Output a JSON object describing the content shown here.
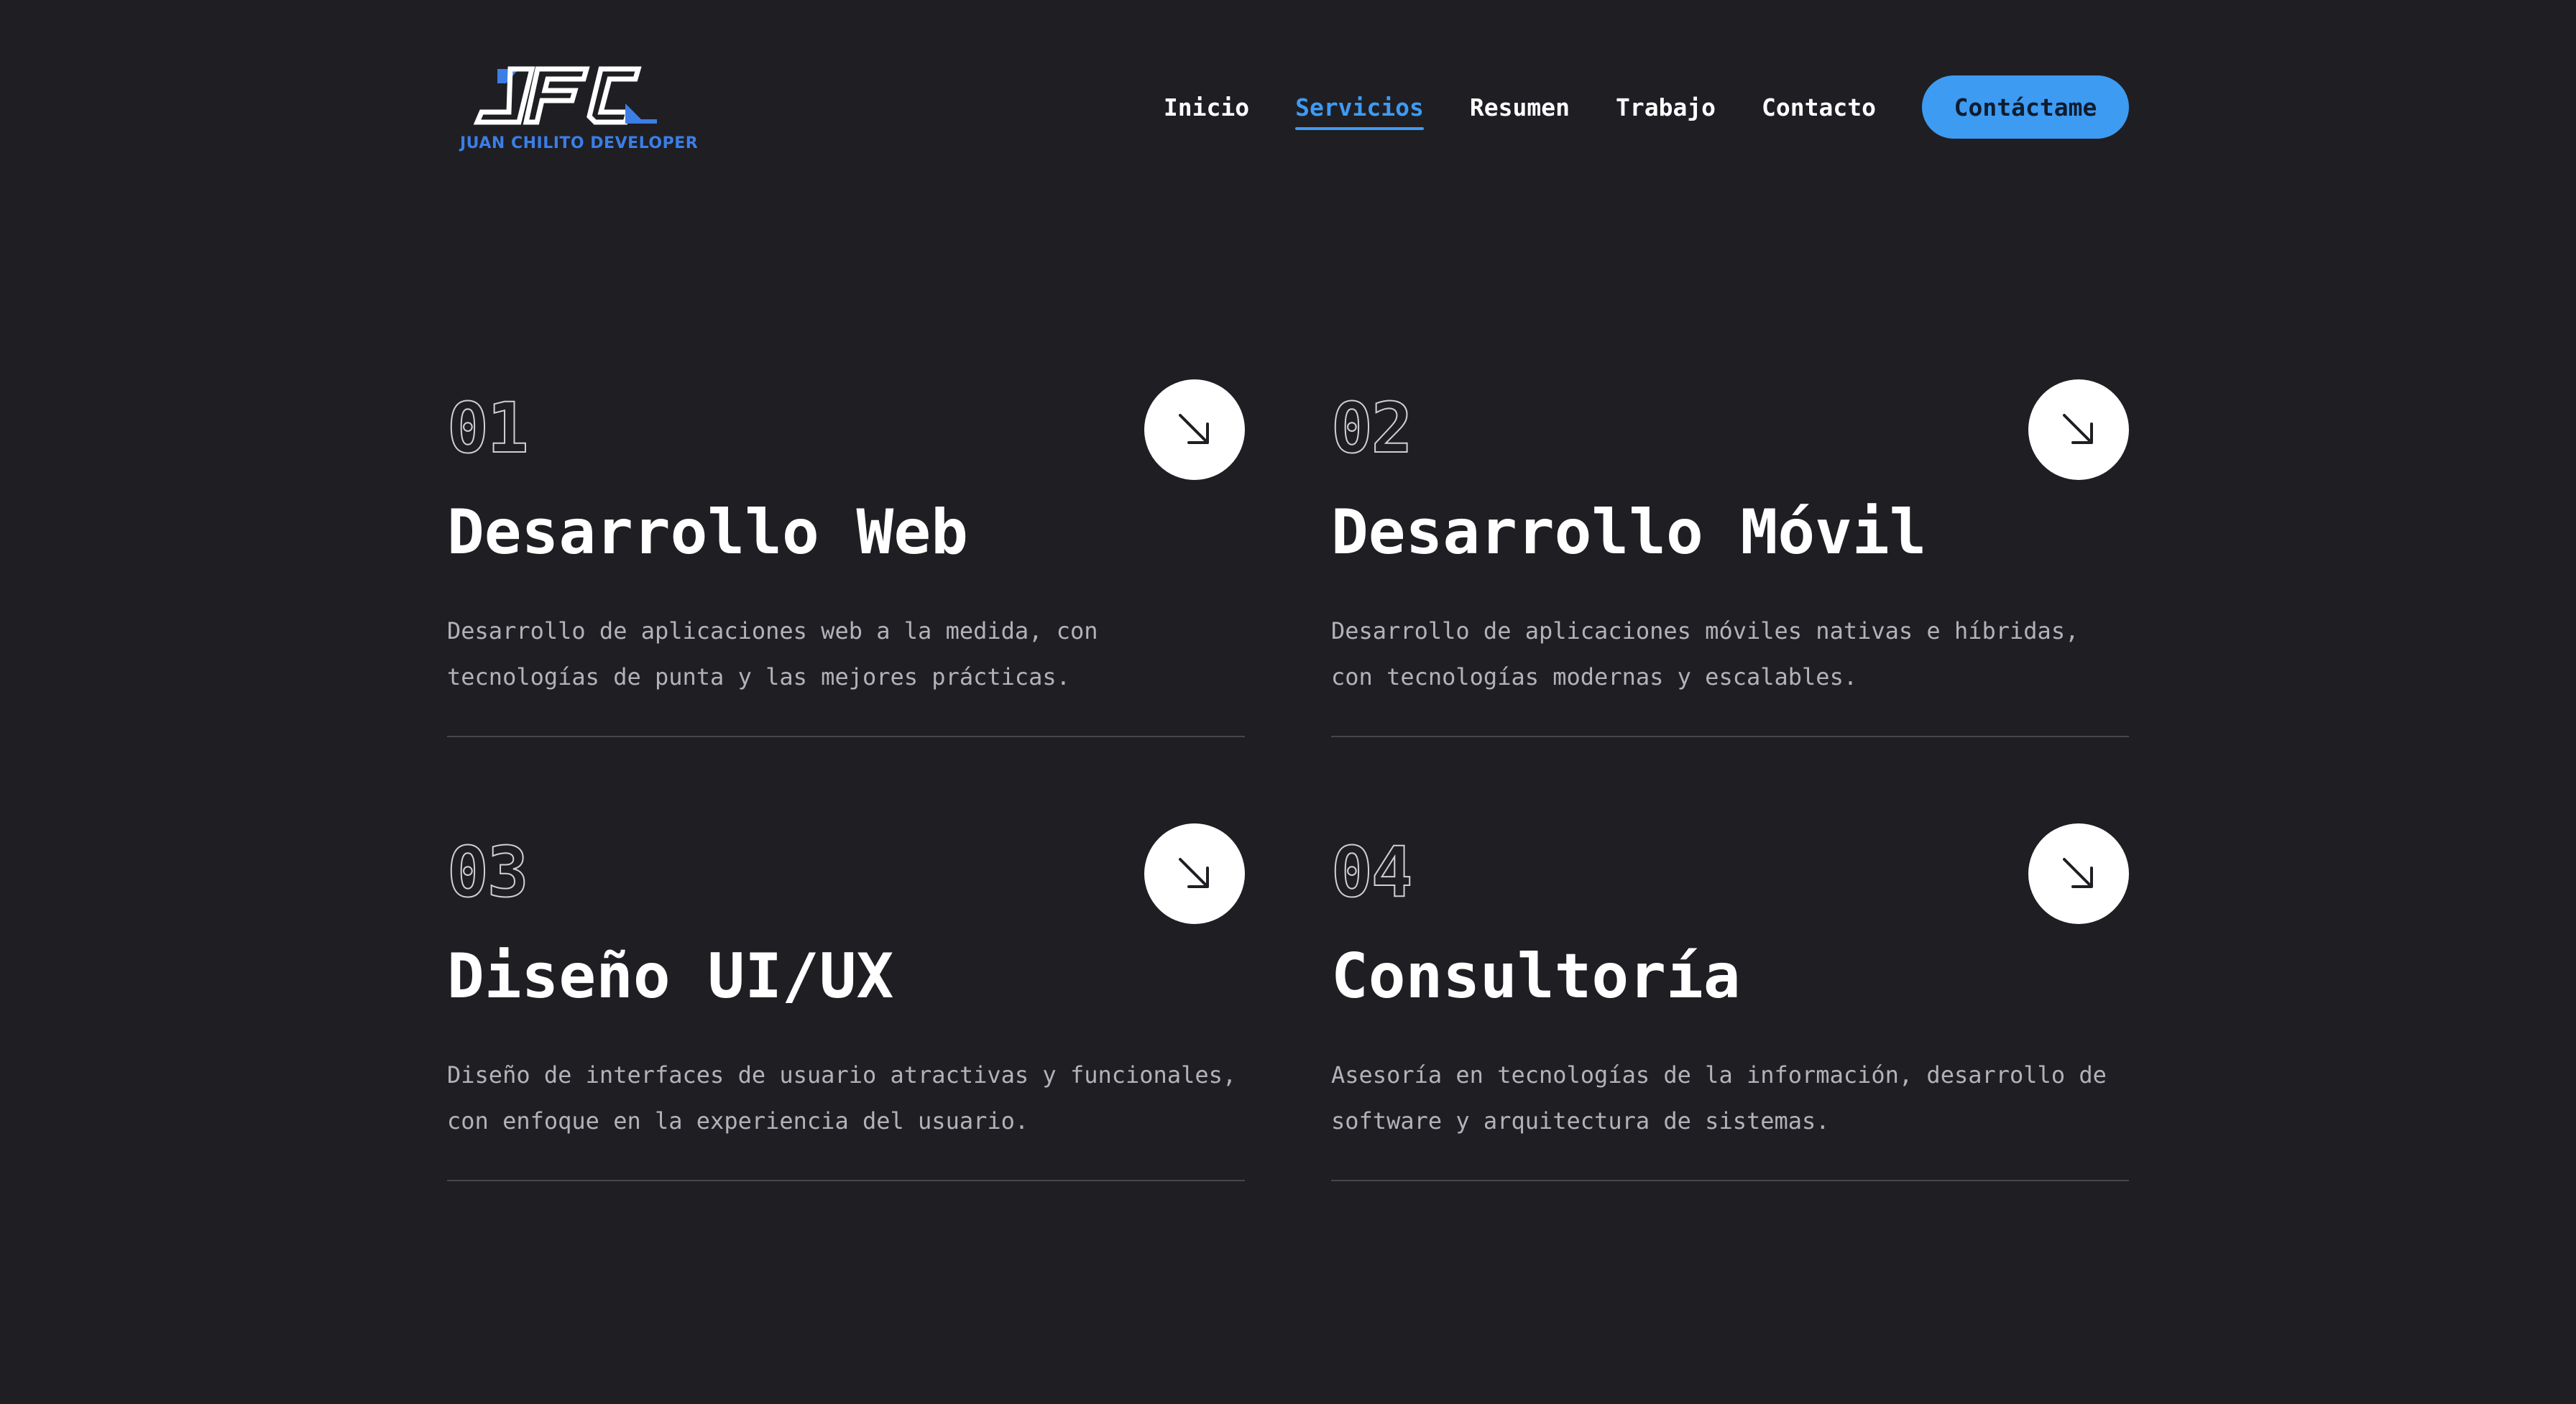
{
  "header": {
    "logo_text": "JFC",
    "logo_subtitle": "JUAN CHILITO DEVELOPER",
    "nav": [
      {
        "label": "Inicio",
        "active": false
      },
      {
        "label": "Servicios",
        "active": true
      },
      {
        "label": "Resumen",
        "active": false
      },
      {
        "label": "Trabajo",
        "active": false
      },
      {
        "label": "Contacto",
        "active": false
      }
    ],
    "cta_label": "Contáctame"
  },
  "services": [
    {
      "number": "01",
      "title": "Desarrollo Web",
      "description": "Desarrollo de aplicaciones web a la medida, con tecnologías de punta y las mejores prácticas.",
      "icon": "arrow-down-right-icon"
    },
    {
      "number": "02",
      "title": "Desarrollo Móvil",
      "description": "Desarrollo de aplicaciones móviles nativas e híbridas, con tecnologías modernas y escalables.",
      "icon": "arrow-down-right-icon"
    },
    {
      "number": "03",
      "title": "Diseño UI/UX",
      "description": "Diseño de interfaces de usuario atractivas y funcionales, con enfoque en la experiencia del usuario.",
      "icon": "arrow-down-right-icon"
    },
    {
      "number": "04",
      "title": "Consultoría",
      "description": "Asesoría en tecnologías de la información, desarrollo de software y arquitectura de sistemas.",
      "icon": "arrow-down-right-icon"
    }
  ],
  "colors": {
    "background": "#1f1e23",
    "accent": "#3d9bf2",
    "logo_blue": "#3b7ee6",
    "text": "#ffffff",
    "muted_text": "#b3b2b8",
    "divider": "#48474d"
  }
}
